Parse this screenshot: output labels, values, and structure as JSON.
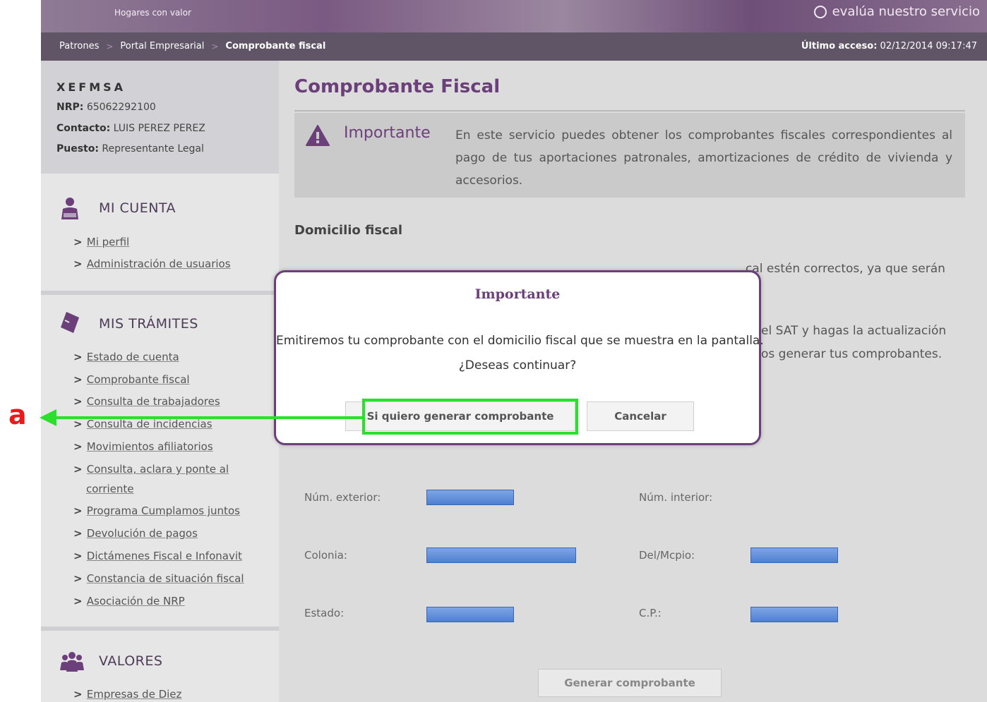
{
  "header": {
    "tagline": "Hogares con valor",
    "feedback_label": "evalúa nuestro servicio"
  },
  "breadcrumb": {
    "items": [
      "Patrones",
      "Portal Empresarial",
      "Comprobante fiscal"
    ],
    "last_access_label": "Último acceso:",
    "last_access_value": "02/12/2014 09:17:47"
  },
  "account": {
    "code": "XEFMSA",
    "nrp_label": "NRP:",
    "nrp_value": "65062292100",
    "contact_label": "Contacto:",
    "contact_value": "LUIS PEREZ PEREZ",
    "role_label": "Puesto:",
    "role_value": "Representante Legal"
  },
  "sidebar": {
    "mi_cuenta": {
      "title": "MI CUENTA",
      "icon": "user-icon",
      "items": [
        "Mi perfil",
        "Administración de usuarios"
      ]
    },
    "mis_tramites": {
      "title": "MIS TRÁMITES",
      "icon": "document-icon",
      "items": [
        "Estado de cuenta",
        "Comprobante fiscal",
        "Consulta de trabajadores",
        "Consulta de incidencias",
        "Movimientos afiliatorios",
        "Consulta, aclara y ponte al",
        "corriente",
        "Programa Cumplamos juntos",
        "Devolución de pagos",
        "Dictámenes Fiscal e Infonavit",
        "Constancia de situación fiscal",
        "Asociación de NRP"
      ]
    },
    "valores": {
      "title": "VALORES",
      "icon": "group-icon",
      "items": [
        "Empresas de Diez"
      ]
    }
  },
  "main": {
    "title": "Comprobante Fiscal",
    "notice_heading": "Importante",
    "notice_text": "En este servicio puedes obtener los comprobantes fiscales correspondientes al pago de tus aportaciones patronales, amortizaciones de crédito de vivienda y accesorios.",
    "domicilio_heading": "Domicilio fiscal",
    "para1_visible": "cal estén correctos, ya que serán",
    "para2_line1_visible": "el SAT y hagas la actualización",
    "para2_line2_visible": "os generar tus comprobantes.",
    "fields": {
      "num_exterior": "Núm. exterior:",
      "num_interior": "Núm. interior:",
      "colonia": "Colonia:",
      "del_mcpio": "Del/Mcpio:",
      "estado": "Estado:",
      "cp": "C.P.:"
    },
    "generate_button": "Generar comprobante"
  },
  "modal": {
    "title": "Importante",
    "line1": "Emitiremos tu comprobante con el domicilio fiscal que se muestra en la pantalla.",
    "line2": "¿Deseas continuar?",
    "confirm_button": "Si quiero generar comprobante",
    "cancel_button": "Cancelar"
  },
  "annotation": {
    "label": "a",
    "color": "#29e02d",
    "label_color": "#e61c1c"
  },
  "colors": {
    "brand_purple": "#6b3f7a",
    "breadcrumb_bar": "#5f5566",
    "field_blue": "#4f7fd0"
  }
}
